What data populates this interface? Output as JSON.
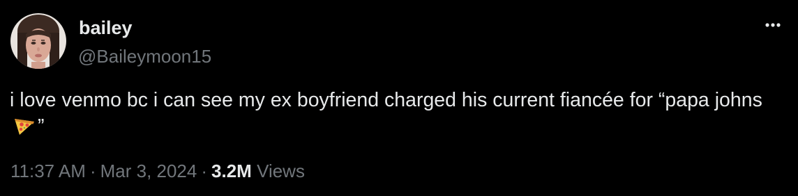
{
  "tweet": {
    "author": {
      "display_name": "bailey",
      "handle": "@Baileymoon15",
      "avatar_icon": "avatar-photo"
    },
    "menu_icon": "more-horizontal-icon",
    "text_before_emoji": "i love venmo bc i can see my ex boyfriend charged his current fiancée for “papa johns",
    "emoji_icon": "pizza-emoji-icon",
    "text_after_emoji": "”",
    "time": "11:37 AM",
    "separator": "·",
    "date": "Mar 3, 2024",
    "views_count": "3.2M",
    "views_label": "Views"
  },
  "colors": {
    "background": "#000000",
    "primary_text": "#e7e9ea",
    "secondary_text": "#71767b"
  }
}
